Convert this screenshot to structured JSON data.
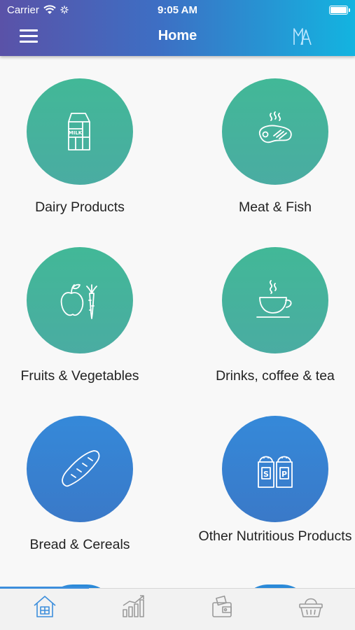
{
  "status_bar": {
    "carrier": "Carrier",
    "time": "9:05 AM"
  },
  "header": {
    "title": "Home"
  },
  "categories": [
    {
      "label": "Dairy Products",
      "icon": "milk-carton-icon",
      "color": "teal"
    },
    {
      "label": "Meat & Fish",
      "icon": "steak-icon",
      "color": "teal"
    },
    {
      "label": "Fruits & Vegetables",
      "icon": "apple-carrot-icon",
      "color": "teal"
    },
    {
      "label": "Drinks, coffee & tea",
      "icon": "coffee-cup-icon",
      "color": "teal"
    },
    {
      "label": "Bread & Cereals",
      "icon": "bread-icon",
      "color": "blue"
    },
    {
      "label": "Other Nutritious Products",
      "icon": "salt-pepper-icon",
      "color": "blue"
    }
  ],
  "tabs": [
    {
      "name": "home",
      "icon": "house-icon",
      "active": true
    },
    {
      "name": "stats",
      "icon": "bar-chart-icon",
      "active": false
    },
    {
      "name": "wallet",
      "icon": "wallet-icon",
      "active": false
    },
    {
      "name": "basket",
      "icon": "basket-icon",
      "active": false
    }
  ],
  "colors": {
    "accent": "#3c8edc",
    "teal": "#45b49c",
    "blue": "#3585d6",
    "nav_start": "#5a52a8",
    "nav_end": "#13b4e0"
  }
}
